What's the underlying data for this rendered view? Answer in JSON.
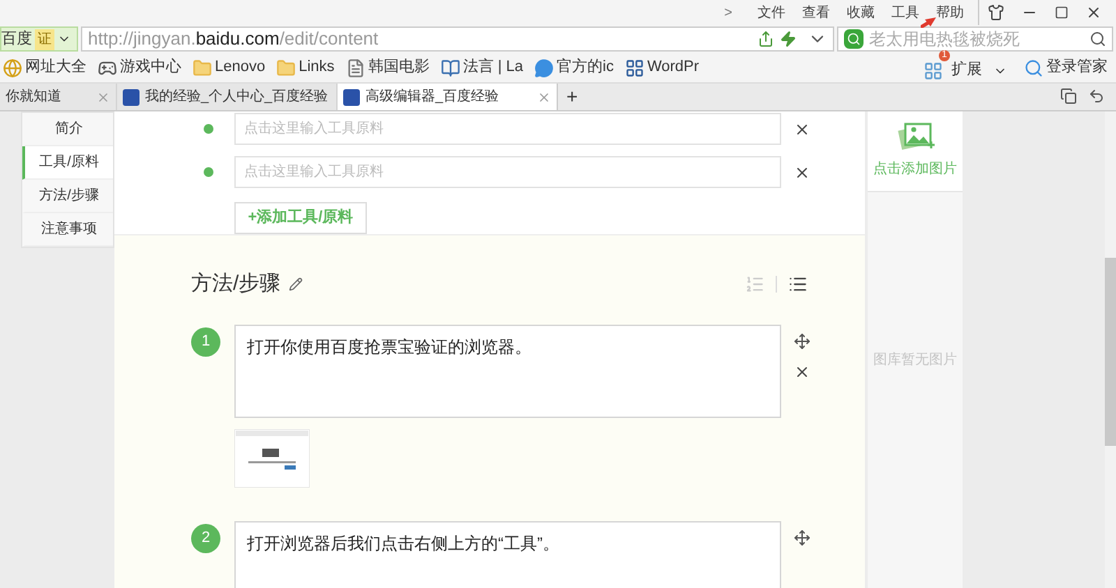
{
  "menu_bar": {
    "chevron": ">",
    "items": [
      "文件",
      "查看",
      "收藏",
      "工具",
      "帮助"
    ]
  },
  "address_bar": {
    "site_label": "百度",
    "cert_badge": "证",
    "url_plain_start": "http://jingyan.",
    "url_domain": "baidu.com",
    "url_plain_end": "/edit/content",
    "search": {
      "placeholder": "老太用电热毯被烧死"
    }
  },
  "bookmarks": {
    "items": [
      {
        "label": "网址大全",
        "kind": "globe"
      },
      {
        "label": "游戏中心",
        "kind": "game"
      },
      {
        "label": "Lenovo",
        "kind": "folder"
      },
      {
        "label": "Links",
        "kind": "folder"
      },
      {
        "label": "韩国电影",
        "kind": "page"
      },
      {
        "label": "法言 | La",
        "kind": "book"
      },
      {
        "label": "官方的ic",
        "kind": "chat"
      },
      {
        "label": "WordPr",
        "kind": "app"
      }
    ],
    "extensions": {
      "label": "扩展",
      "badge": "1"
    },
    "login": "登录管家"
  },
  "tabs": [
    {
      "title": "你就知道",
      "selected": false,
      "has_icon": false
    },
    {
      "title": "我的经验_个人中心_百度经验",
      "selected": false,
      "has_icon": true
    },
    {
      "title": "高级编辑器_百度经验",
      "selected": true,
      "has_icon": true
    }
  ],
  "new_tab": "+",
  "side_nav": [
    {
      "label": "简介",
      "selected": false
    },
    {
      "label": "工具/原料",
      "selected": true
    },
    {
      "label": "方法/步骤",
      "selected": false
    },
    {
      "label": "注意事项",
      "selected": false
    }
  ],
  "tools": {
    "inputs": [
      {
        "placeholder": "点击这里输入工具原料"
      },
      {
        "placeholder": "点击这里输入工具原料"
      }
    ],
    "add_button": "+添加工具/原料"
  },
  "steps_section": {
    "title": "方法/步骤",
    "steps": [
      {
        "number": "1",
        "text": "打开你使用百度抢票宝验证的浏览器。",
        "has_thumbnail": true
      },
      {
        "number": "2",
        "text": "打开浏览器后我们点击右侧上方的“工具”。",
        "has_thumbnail": false
      }
    ]
  },
  "image_panel": {
    "add_label": "点击添加图片",
    "empty_text": "图库暂无图片"
  }
}
